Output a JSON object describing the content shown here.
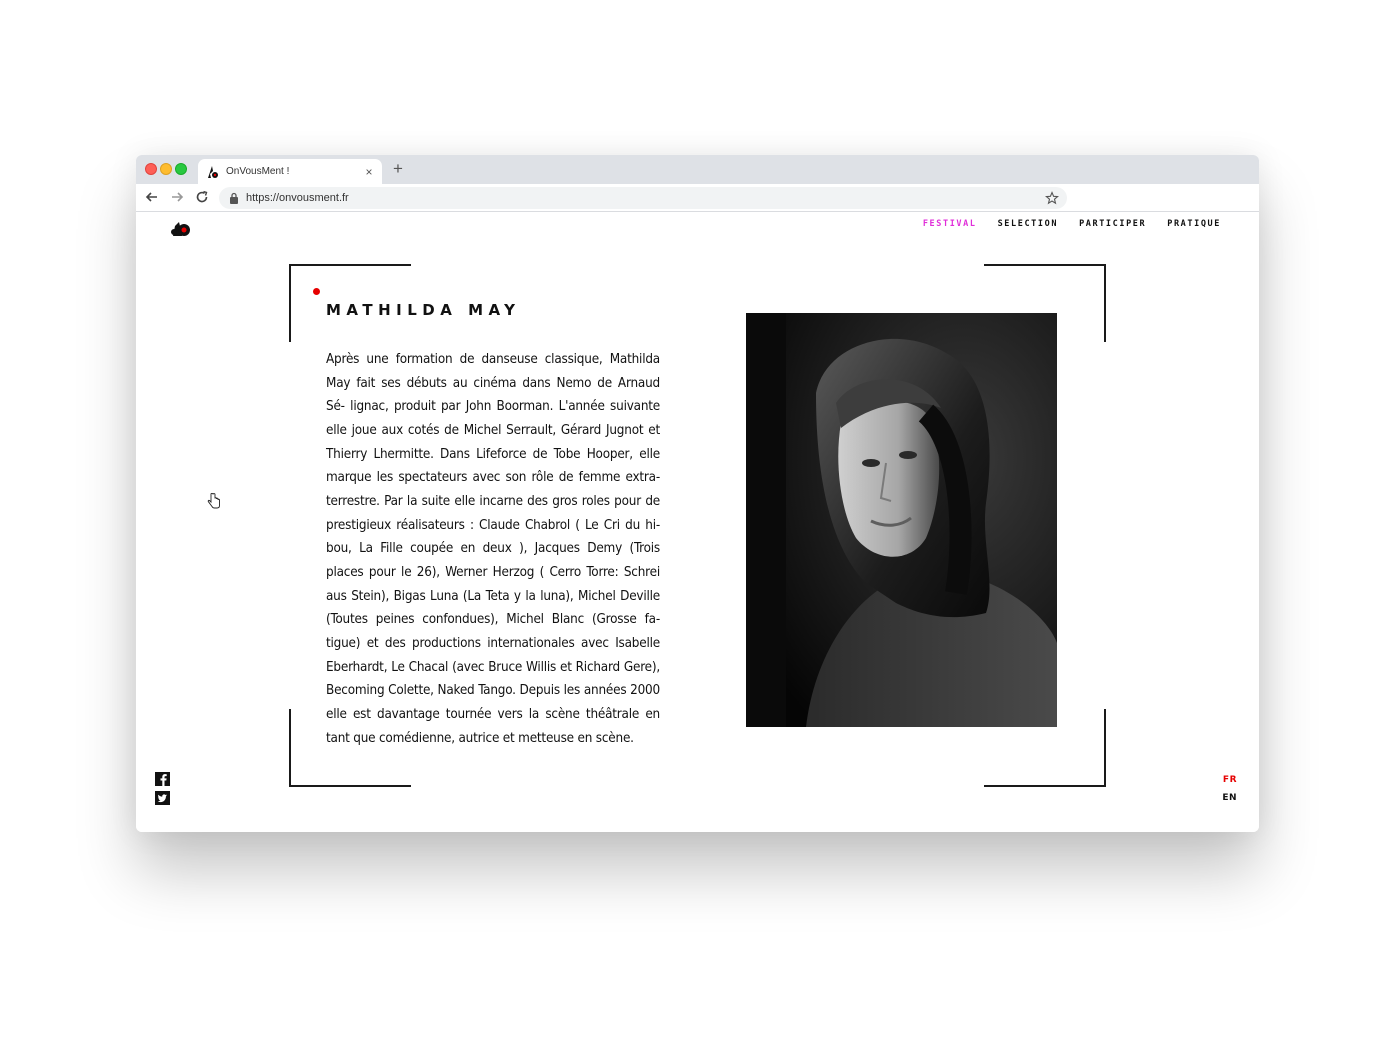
{
  "browser": {
    "tab_title": "OnVousMent !",
    "tab_close": "×",
    "new_tab": "+",
    "url": "https://onvousment.fr"
  },
  "nav": {
    "items": [
      "FESTIVAL",
      "SELECTION",
      "PARTICIPER",
      "PRATIQUE"
    ],
    "active_color": "#e02ed9"
  },
  "profile": {
    "name": "MATHILDA MAY",
    "bio": "Après une formation de danseuse classique, Mathilda May fait ses débuts au cinéma dans Nemo de Arnaud Sé- lignac, produit par John Boorman. L'année suivante elle joue aux cotés de Michel Serrault, Gérard Jugnot et Thierry Lhermitte. Dans Lifeforce de Tobe Hooper, elle marque les spectateurs avec son rôle de femme extra- terrestre. Par la suite elle incarne des gros roles pour de prestigieux réalisateurs : Claude Chabrol ( Le Cri du hi- bou, La Fille coupée en deux ), Jacques Demy (Trois places pour le 26), Werner Herzog ( Cerro Torre: Schrei aus Stein), Bigas Luna (La Teta y la luna), Michel Deville (Toutes peines confondues), Michel Blanc (Grosse fa- tigue) et des productions internationales avec Isabelle Eberhardt, Le Chacal (avec Bruce Willis et Richard Gere), Becoming Colette, Naked Tango. Depuis les années 2000 elle est davantage tournée vers la scène théâtrale en tant que comédienne, autrice et metteuse en scène."
  },
  "languages": {
    "fr": "FR",
    "en": "EN",
    "active_color": "#e60000"
  },
  "icons": {
    "social": [
      "facebook-icon",
      "twitter-icon"
    ]
  }
}
